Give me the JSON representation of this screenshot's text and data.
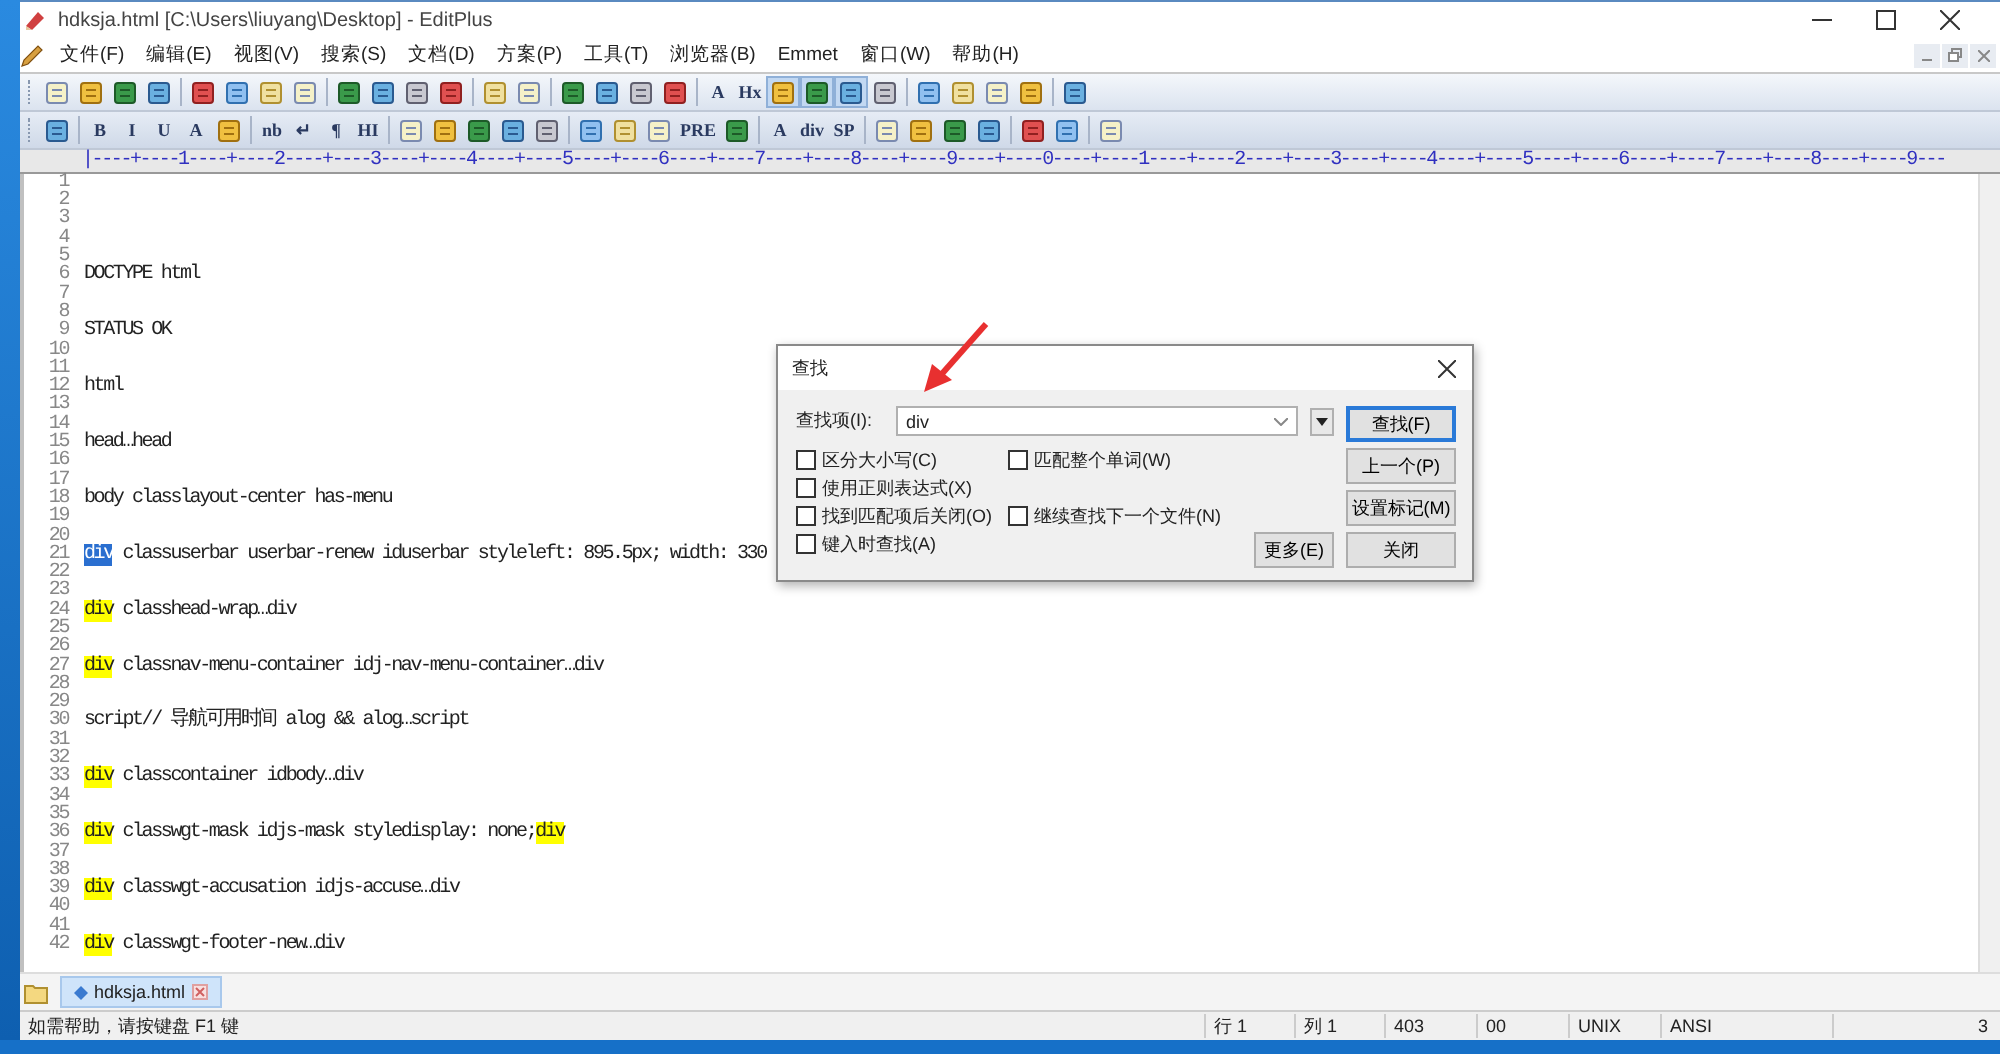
{
  "window": {
    "title": "hdksja.html [C:\\Users\\liuyang\\Desktop] - EditPlus"
  },
  "menu": [
    "文件(F)",
    "编辑(E)",
    "视图(V)",
    "搜索(S)",
    "文档(D)",
    "方案(P)",
    "工具(T)",
    "浏览器(B)",
    "Emmet",
    "窗口(W)",
    "帮助(H)"
  ],
  "toolbar_1": [
    {
      "kind": "icon",
      "on": false
    },
    {
      "kind": "icon",
      "on": false
    },
    {
      "kind": "icon",
      "on": false
    },
    {
      "kind": "icon",
      "on": false
    },
    {
      "kind": "separator"
    },
    {
      "kind": "icon",
      "on": false
    },
    {
      "kind": "icon",
      "on": false
    },
    {
      "kind": "icon",
      "on": false
    },
    {
      "kind": "icon",
      "on": false
    },
    {
      "kind": "separator"
    },
    {
      "kind": "icon",
      "on": false
    },
    {
      "kind": "icon",
      "on": false
    },
    {
      "kind": "icon",
      "on": false
    },
    {
      "kind": "icon",
      "on": false
    },
    {
      "kind": "separator"
    },
    {
      "kind": "icon",
      "on": false
    },
    {
      "kind": "icon",
      "on": false
    },
    {
      "kind": "separator"
    },
    {
      "kind": "icon",
      "on": false
    },
    {
      "kind": "icon",
      "on": false
    },
    {
      "kind": "icon",
      "on": false
    },
    {
      "kind": "icon",
      "on": false
    },
    {
      "kind": "separator"
    },
    {
      "kind": "text",
      "label": "A",
      "on": false
    },
    {
      "kind": "text",
      "label": "Hx",
      "on": false
    },
    {
      "kind": "icon",
      "on": true
    },
    {
      "kind": "icon",
      "on": true
    },
    {
      "kind": "icon",
      "on": true
    },
    {
      "kind": "icon",
      "on": false
    },
    {
      "kind": "separator"
    },
    {
      "kind": "icon",
      "on": false
    },
    {
      "kind": "icon",
      "on": false
    },
    {
      "kind": "icon",
      "on": false
    },
    {
      "kind": "icon",
      "on": false
    },
    {
      "kind": "separator"
    },
    {
      "kind": "icon",
      "on": false
    }
  ],
  "toolbar_2": [
    {
      "kind": "icon",
      "on": false
    },
    {
      "kind": "separator"
    },
    {
      "kind": "text",
      "label": "B",
      "on": false
    },
    {
      "kind": "text",
      "label": "I",
      "on": false
    },
    {
      "kind": "text",
      "label": "U",
      "on": false
    },
    {
      "kind": "text",
      "label": "A",
      "on": false
    },
    {
      "kind": "icon",
      "on": false
    },
    {
      "kind": "separator"
    },
    {
      "kind": "text",
      "label": "nb",
      "on": false
    },
    {
      "kind": "text",
      "label": "↵",
      "on": false
    },
    {
      "kind": "text",
      "label": "¶",
      "on": false
    },
    {
      "kind": "text",
      "label": "HI",
      "on": false
    },
    {
      "kind": "separator"
    },
    {
      "kind": "icon",
      "on": false
    },
    {
      "kind": "icon",
      "on": false
    },
    {
      "kind": "icon",
      "on": false
    },
    {
      "kind": "icon",
      "on": false
    },
    {
      "kind": "icon",
      "on": false
    },
    {
      "kind": "separator"
    },
    {
      "kind": "icon",
      "on": false
    },
    {
      "kind": "icon",
      "on": false
    },
    {
      "kind": "icon",
      "on": false
    },
    {
      "kind": "text",
      "label": "PRE",
      "on": false
    },
    {
      "kind": "icon",
      "on": false
    },
    {
      "kind": "separator"
    },
    {
      "kind": "text",
      "label": "A",
      "on": false
    },
    {
      "kind": "text",
      "label": "div",
      "on": false
    },
    {
      "kind": "text",
      "label": "SP",
      "on": false
    },
    {
      "kind": "separator"
    },
    {
      "kind": "icon",
      "on": false
    },
    {
      "kind": "icon",
      "on": false
    },
    {
      "kind": "icon",
      "on": false
    },
    {
      "kind": "icon",
      "on": false
    },
    {
      "kind": "separator"
    },
    {
      "kind": "icon",
      "on": false
    },
    {
      "kind": "icon",
      "on": false
    },
    {
      "kind": "separator"
    },
    {
      "kind": "icon",
      "on": false
    }
  ],
  "ruler": "|----+----1----+----2----+----3----+----4----+----5----+----6----+----7----+----8----+----9----+----0----+----1----+----2----+----3----+----4----+----5----+----6----+----7----+----8----+----9---",
  "lines": [
    {
      "number": "1"
    },
    {
      "number": "2"
    },
    {
      "number": "3"
    },
    {
      "number": "4"
    },
    {
      "number": "5"
    },
    {
      "number": "6",
      "parts": [
        {
          "text": "DOCTYPE html",
          "kind": "plain"
        }
      ]
    },
    {
      "number": "7"
    },
    {
      "number": "8"
    },
    {
      "number": "9",
      "parts": [
        {
          "text": "STATUS OK",
          "kind": "plain"
        }
      ]
    },
    {
      "number": "10"
    },
    {
      "number": "11"
    },
    {
      "number": "12",
      "parts": [
        {
          "text": "html",
          "kind": "plain"
        }
      ]
    },
    {
      "number": "13"
    },
    {
      "number": "14"
    },
    {
      "number": "15",
      "parts": [
        {
          "text": "head…head",
          "kind": "plain"
        }
      ]
    },
    {
      "number": "16"
    },
    {
      "number": "17"
    },
    {
      "number": "18",
      "parts": [
        {
          "text": "body classlayout-center has-menu",
          "kind": "plain"
        }
      ]
    },
    {
      "number": "19"
    },
    {
      "number": "20"
    },
    {
      "number": "21",
      "parts": [
        {
          "text": "div",
          "kind": "selected"
        },
        {
          "text": " classuserbar userbar-renew iduserbar styleleft: 895.5px; width: 330",
          "kind": "plain"
        }
      ]
    },
    {
      "number": "22"
    },
    {
      "number": "23"
    },
    {
      "number": "24",
      "parts": [
        {
          "text": "div",
          "kind": "match"
        },
        {
          "text": " classhead-wrap…div",
          "kind": "plain"
        }
      ]
    },
    {
      "number": "25"
    },
    {
      "number": "26"
    },
    {
      "number": "27",
      "parts": [
        {
          "text": "div",
          "kind": "match"
        },
        {
          "text": " classnav-menu-container idj-nav-menu-container…div",
          "kind": "plain"
        }
      ]
    },
    {
      "number": "28"
    },
    {
      "number": "29"
    },
    {
      "number": "30",
      "parts": [
        {
          "text": "script// 导航可用时间 alog && alog…script",
          "kind": "plain"
        }
      ]
    },
    {
      "number": "31"
    },
    {
      "number": "32"
    },
    {
      "number": "33",
      "parts": [
        {
          "text": "div",
          "kind": "match"
        },
        {
          "text": " classcontainer idbody…div",
          "kind": "plain"
        }
      ]
    },
    {
      "number": "34"
    },
    {
      "number": "35"
    },
    {
      "number": "36",
      "parts": [
        {
          "text": "div",
          "kind": "match"
        },
        {
          "text": " classwgt-mask idjs-mask styledisplay: none;",
          "kind": "plain"
        },
        {
          "text": "div",
          "kind": "match"
        }
      ]
    },
    {
      "number": "37"
    },
    {
      "number": "38"
    },
    {
      "number": "39",
      "parts": [
        {
          "text": "div",
          "kind": "match"
        },
        {
          "text": " classwgt-accusation idjs-accuse…div",
          "kind": "plain"
        }
      ]
    },
    {
      "number": "40"
    },
    {
      "number": "41"
    },
    {
      "number": "42",
      "parts": [
        {
          "text": "div",
          "kind": "match"
        },
        {
          "text": " classwgt-footer-new…div",
          "kind": "plain"
        }
      ]
    }
  ],
  "tabs": [
    {
      "label": "hdksja.html",
      "selected": true
    }
  ],
  "status_bar": {
    "help": "如需帮助，请按键盘 F1 键",
    "line": "行 1",
    "column": "列 1",
    "size": "403",
    "code": "00",
    "line_ending": "UNIX",
    "encoding": "ANSI",
    "extra": "3"
  },
  "find_dialog": {
    "title": "查找",
    "label": "查找项(I):",
    "value": "div",
    "option_rows": [
      [
        {
          "label": "区分大小写(C)",
          "checked": false
        },
        {
          "label": "匹配整个单词(W)",
          "checked": false
        }
      ],
      [
        {
          "label": "使用正则表达式(X)",
          "checked": false
        }
      ],
      [
        {
          "label": "找到匹配项后关闭(O)",
          "checked": false
        },
        {
          "label": "继续查找下一个文件(N)",
          "checked": false
        }
      ],
      [
        {
          "label": "键入时查找(A)",
          "checked": false
        }
      ]
    ],
    "more_button": "更多(E)",
    "buttons": [
      {
        "label": "查找(F)",
        "default": true
      },
      {
        "label": "上一个(P)",
        "default": false
      },
      {
        "label": "设置标记(M)",
        "default": false
      },
      {
        "label": "关闭",
        "default": false
      }
    ]
  }
}
